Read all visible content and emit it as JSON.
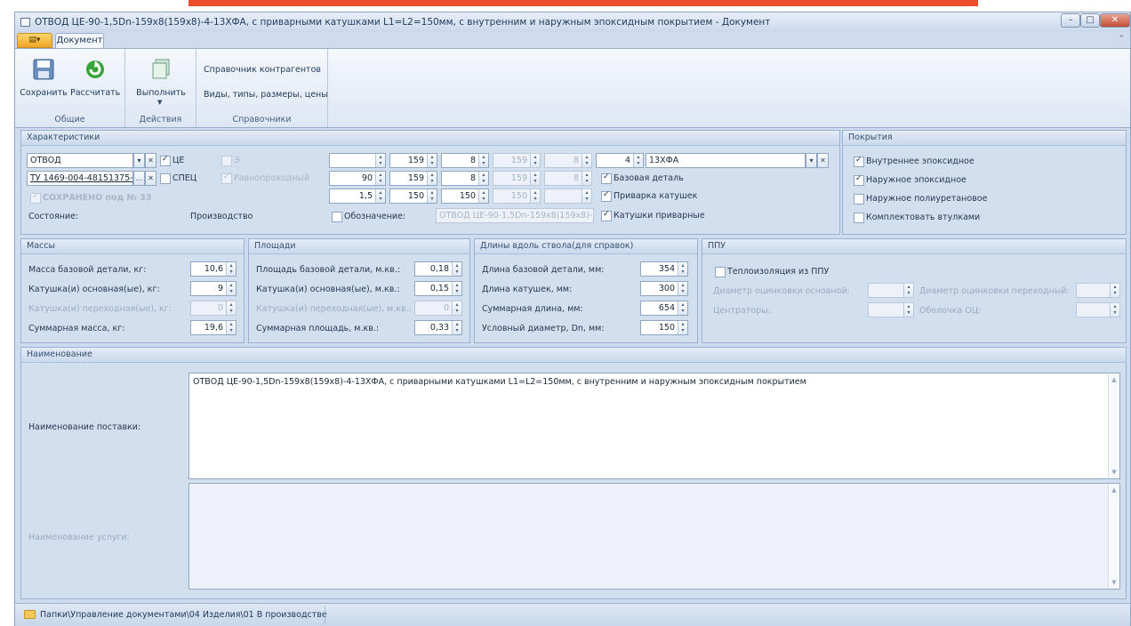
{
  "window": {
    "title": "ОТВОД ЦЕ-90-1,5Dn-159x8(159x8)-4-13ХФА, с приварными катушками L1=L2=150мм, с внутренним и наружным эпоксидным покрытием - Документ",
    "accent_color": "#ea4e2a"
  },
  "tabs": {
    "doc": "Документ"
  },
  "ribbon": {
    "save": "Сохранить",
    "calc": "Рассчитать",
    "group_common": "Общие",
    "execute": "Выполнить",
    "group_actions": "Действия",
    "ref_contractors": "Справочник контрагентов",
    "ref_types": "Виды, типы, размеры, цены",
    "group_refs": "Справочники"
  },
  "char": {
    "title": "Характеристики",
    "type_value": "ОТВОД",
    "tu_value": "ТУ 1469-004-48151375-",
    "cb_ce": "ЦЕ",
    "cb_spec": "СПЕЦ",
    "cb_e": "Э",
    "cb_ravno": "Равнопроходный",
    "saved": "СОХРАНЕНО под № 33",
    "state_label": "Состояние:",
    "state_value": "Производство",
    "cb_oboz": "Обозначение:",
    "oboz_value": "ОТВОД ЦЕ-90-1,5Dn-159x8(159x8)-...",
    "row1": [
      "",
      "159",
      "8",
      "159",
      "8",
      "4"
    ],
    "row2": [
      "90",
      "159",
      "8",
      "159",
      "8"
    ],
    "row3": [
      "1,5",
      "150",
      "150",
      "150",
      ""
    ],
    "steel": "13ХФА",
    "cb_base": "Базовая деталь",
    "cb_weld": "Приварка катушек",
    "cb_coils": "Катушки приварные"
  },
  "coat": {
    "title": "Покрытия",
    "inner": "Внутреннее эпоксидное",
    "outer": "Наружное эпоксидное",
    "poly": "Наружное полиуретановое",
    "sleeves": "Комплектовать втулками"
  },
  "mass": {
    "title": "Массы",
    "l1": "Масса базовой детали, кг:",
    "v1": "10,6",
    "l2": "Катушка(и) основная(ые), кг:",
    "v2": "9",
    "l3": "Катушка(и) переходная(ые), кг:",
    "v3": "0",
    "l4": "Суммарная масса, кг:",
    "v4": "19,6"
  },
  "area": {
    "title": "Площади",
    "l1": "Площадь базовой детали, м.кв.:",
    "v1": "0,18",
    "l2": "Катушка(и) основная(ые), м.кв.:",
    "v2": "0,15",
    "l3": "Катушка(и) переходная(ые), м.кв.:",
    "v3": "0",
    "l4": "Суммарная площадь, м.кв.:",
    "v4": "0,33"
  },
  "len": {
    "title": "Длины вдоль ствола(для справок)",
    "l1": "Длина базовой детали, мм:",
    "v1": "354",
    "l2": "Длина катушек, мм:",
    "v2": "300",
    "l3": "Суммарная длина, мм:",
    "v3": "654",
    "l4": "Условный диаметр, Dn, мм:",
    "v4": "150"
  },
  "ppu": {
    "title": "ППУ",
    "cb": "Теплоизоляция из ППУ",
    "d1": "Диаметр оцинковки основной:",
    "d2": "Диаметр оцинковки переходный:",
    "c1": "Центраторы:",
    "c2": "Оболочка ОЦ:"
  },
  "name": {
    "title": "Наименование",
    "supply_label": "Наименование поставки:",
    "supply_value": "ОТВОД ЦЕ-90-1,5Dn-159x8(159x8)-4-13ХФА, с приварными катушками L1=L2=150мм, с внутренним и наружным эпоксидным покрытием",
    "service_label": "Наименование услуги:",
    "service_value": ""
  },
  "status": {
    "path": "Папки\\Управление документами\\04 Изделия\\01 В производстве"
  },
  "icons": [
    "app-menu-icon",
    "save-icon",
    "calculate-icon",
    "execute-icon",
    "folder-icon",
    "minimize-icon",
    "maximize-icon",
    "close-icon"
  ]
}
